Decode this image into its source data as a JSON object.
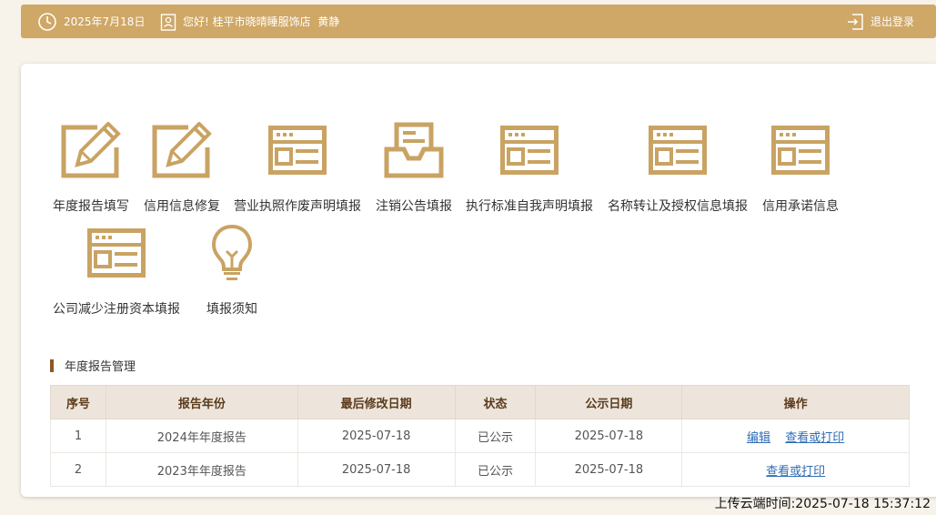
{
  "topbar": {
    "date": "2025年7月18日",
    "greeting": "您好! 桂平市晓晴睡服饰店",
    "user": "黄静",
    "logout": "退出登录",
    "accent": "#cfa766"
  },
  "tiles": [
    {
      "label": "年度报告填写",
      "icon": "edit-icon"
    },
    {
      "label": "信用信息修复",
      "icon": "edit-icon"
    },
    {
      "label": "营业执照作废声明填报",
      "icon": "form-window-icon"
    },
    {
      "label": "注销公告填报",
      "icon": "inbox-tray-icon"
    },
    {
      "label": "执行标准自我声明填报",
      "icon": "form-window-icon"
    },
    {
      "label": "名称转让及授权信息填报",
      "icon": "form-window-icon"
    },
    {
      "label": "信用承诺信息",
      "icon": "form-window-icon"
    },
    {
      "label": "公司减少注册资本填报",
      "icon": "form-window-icon"
    },
    {
      "label": "填报须知",
      "icon": "lightbulb-icon"
    }
  ],
  "section": {
    "title": "年度报告管理"
  },
  "table": {
    "headers": [
      "序号",
      "报告年份",
      "最后修改日期",
      "状态",
      "公示日期",
      "操作"
    ],
    "rows": [
      {
        "no": "1",
        "year": "2024年年度报告",
        "modified": "2025-07-18",
        "status": "已公示",
        "published": "2025-07-18",
        "actions": [
          "编辑",
          "查看或打印"
        ]
      },
      {
        "no": "2",
        "year": "2023年年度报告",
        "modified": "2025-07-18",
        "status": "已公示",
        "published": "2025-07-18",
        "actions": [
          "查看或打印"
        ]
      }
    ]
  },
  "upload_time": "上传云端时间:2025-07-18 15:37:12"
}
